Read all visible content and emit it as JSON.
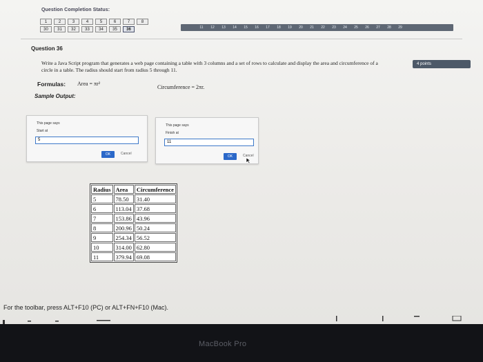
{
  "header": {
    "status_title": "Question Completion Status:"
  },
  "navigation": {
    "row1": [
      "1",
      "2",
      "3",
      "4",
      "5",
      "6",
      "7",
      "8"
    ],
    "row2": [
      "30",
      "31",
      "32",
      "33",
      "34",
      "35",
      "36"
    ],
    "strip": [
      "11",
      "12",
      "13",
      "14",
      "15",
      "16",
      "17",
      "18",
      "19",
      "20",
      "21",
      "22",
      "23",
      "24",
      "25",
      "26",
      "27",
      "28",
      "29"
    ]
  },
  "question": {
    "title": "Question 36",
    "points_label": "4 points",
    "prompt_line1": "Write a Java Script program that generates a web page containing a table with 3 columns and a set of rows to calculate and display the area and circumference of a",
    "prompt_line2": "circle in a table. The radius should start from radius 5 through 11.",
    "formulas_label": "Formulas:",
    "area_formula": "Area = πr²",
    "circumference_formula": "Circumference = 2πr.",
    "sample_output_label": "Sample Output:"
  },
  "dialogs": [
    {
      "title": "This page says",
      "message": "Start at",
      "value": "5",
      "ok_label": "OK",
      "cancel_label": "Cancel"
    },
    {
      "title": "This page says",
      "message": "Finish at",
      "value": "11",
      "ok_label": "OK",
      "cancel_label": "Cancel"
    }
  ],
  "table": {
    "headers": [
      "Radius",
      "Area",
      "Circumference"
    ],
    "rows": [
      [
        "5",
        "78.50",
        "31.40"
      ],
      [
        "6",
        "113.04",
        "37.68"
      ],
      [
        "7",
        "153.86",
        "43.96"
      ],
      [
        "8",
        "200.96",
        "50.24"
      ],
      [
        "9",
        "254.34",
        "56.52"
      ],
      [
        "10",
        "314.00",
        "62.80"
      ],
      [
        "11",
        "379.94",
        "69.08"
      ]
    ]
  },
  "footer": {
    "toolbar_hint": "For the toolbar, press ALT+F10 (PC) or ALT+FN+F10 (Mac)."
  },
  "device": {
    "label": "MacBook Pro"
  }
}
